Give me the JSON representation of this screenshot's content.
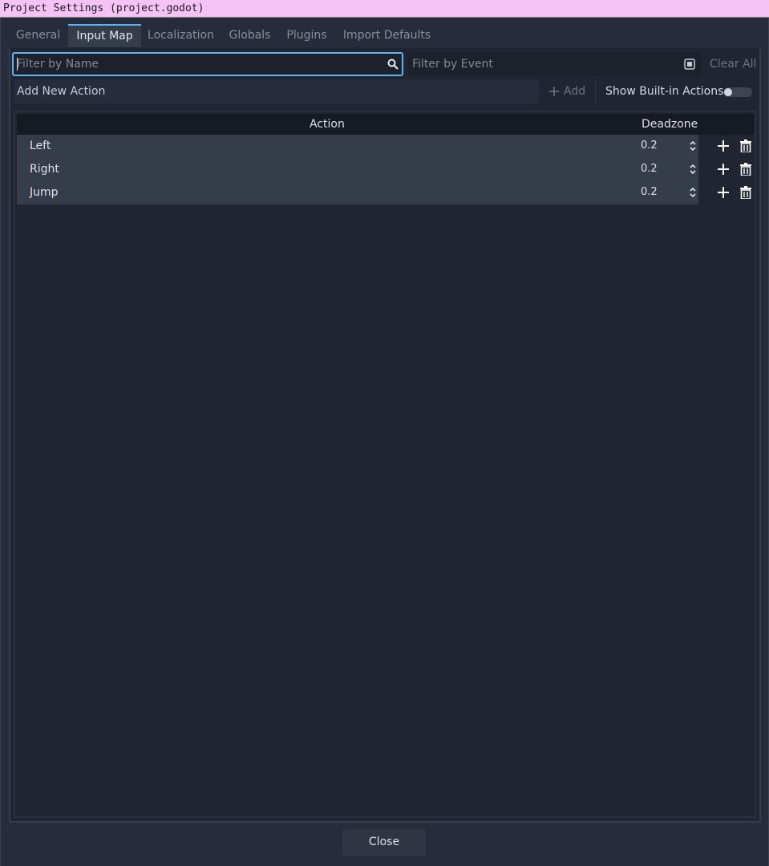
{
  "window": {
    "title": "Project Settings (project.godot)"
  },
  "tabs": [
    {
      "label": "General"
    },
    {
      "label": "Input Map"
    },
    {
      "label": "Localization"
    },
    {
      "label": "Globals"
    },
    {
      "label": "Plugins"
    },
    {
      "label": "Import Defaults"
    }
  ],
  "filters": {
    "name_placeholder": "Filter by Name",
    "event_placeholder": "Filter by Event",
    "clear_all_label": "Clear All"
  },
  "add_action": {
    "placeholder": "Add New Action",
    "add_label": "Add",
    "show_builtin_label": "Show Built-in Actions",
    "show_builtin_enabled": false
  },
  "table": {
    "headers": {
      "action": "Action",
      "deadzone": "Deadzone"
    },
    "rows": [
      {
        "action": "Left",
        "deadzone": "0.2"
      },
      {
        "action": "Right",
        "deadzone": "0.2"
      },
      {
        "action": "Jump",
        "deadzone": "0.2"
      }
    ]
  },
  "footer": {
    "close_label": "Close"
  },
  "colors": {
    "accent": "#5fb2f5",
    "background": "#202531",
    "row": "#363d4a"
  }
}
